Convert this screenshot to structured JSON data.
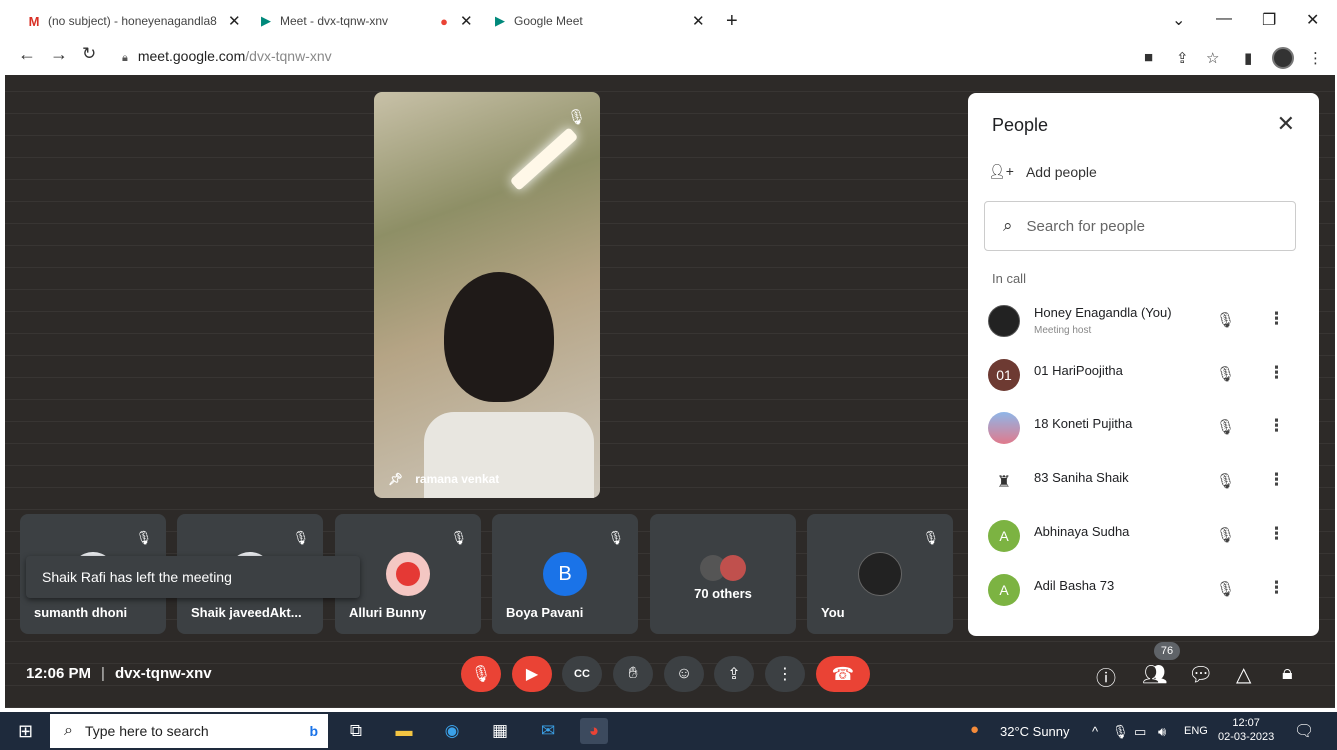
{
  "browser": {
    "tabs": [
      {
        "label": "(no subject) - honeyenagandla8",
        "icon": "gmail-icon"
      },
      {
        "label": "Meet - dvx-tqnw-xnv",
        "icon": "meet-icon"
      },
      {
        "label": "Google Meet",
        "icon": "meet-icon"
      }
    ],
    "new_tab": "+",
    "url_host": "meet.google.com",
    "url_path": "/dvx-tqnw-xnv"
  },
  "meet": {
    "main_video": {
      "name": "ramana venkat"
    },
    "tiles": [
      {
        "name": "sumanth dhoni"
      },
      {
        "name": "Shaik javeedAkt..."
      },
      {
        "name": "Alluri Bunny"
      },
      {
        "name": "Boya Pavani",
        "initial": "B"
      },
      {
        "label": "70 others"
      },
      {
        "name": "You"
      }
    ],
    "toast": "Shaik Rafi has left the meeting",
    "time": "12:06 PM",
    "meeting_code": "dvx-tqnw-xnv",
    "participant_count": "76"
  },
  "people_panel": {
    "title": "People",
    "add_people": "Add people",
    "search_placeholder": "Search for people",
    "section": "In call",
    "people": [
      {
        "name": "Honey Enagandla (You)",
        "role": "Meeting host"
      },
      {
        "name": "01 HariPoojitha",
        "initial": "01",
        "color": "#6d3a32"
      },
      {
        "name": "18 Koneti Pujitha"
      },
      {
        "name": "83 Saniha Shaik"
      },
      {
        "name": "Abhinaya Sudha",
        "initial": "A",
        "color": "#7cb342"
      },
      {
        "name": "Adil Basha 73",
        "initial": "A",
        "color": "#7cb342"
      }
    ]
  },
  "taskbar": {
    "search_placeholder": "Type here to search",
    "weather": "32°C  Sunny",
    "lang": "ENG",
    "time": "12:07",
    "date": "02-03-2023"
  },
  "colors": {
    "accent_red": "#ea4335",
    "tile_bg": "#3c4043",
    "blue_avatar": "#1a73e8"
  }
}
